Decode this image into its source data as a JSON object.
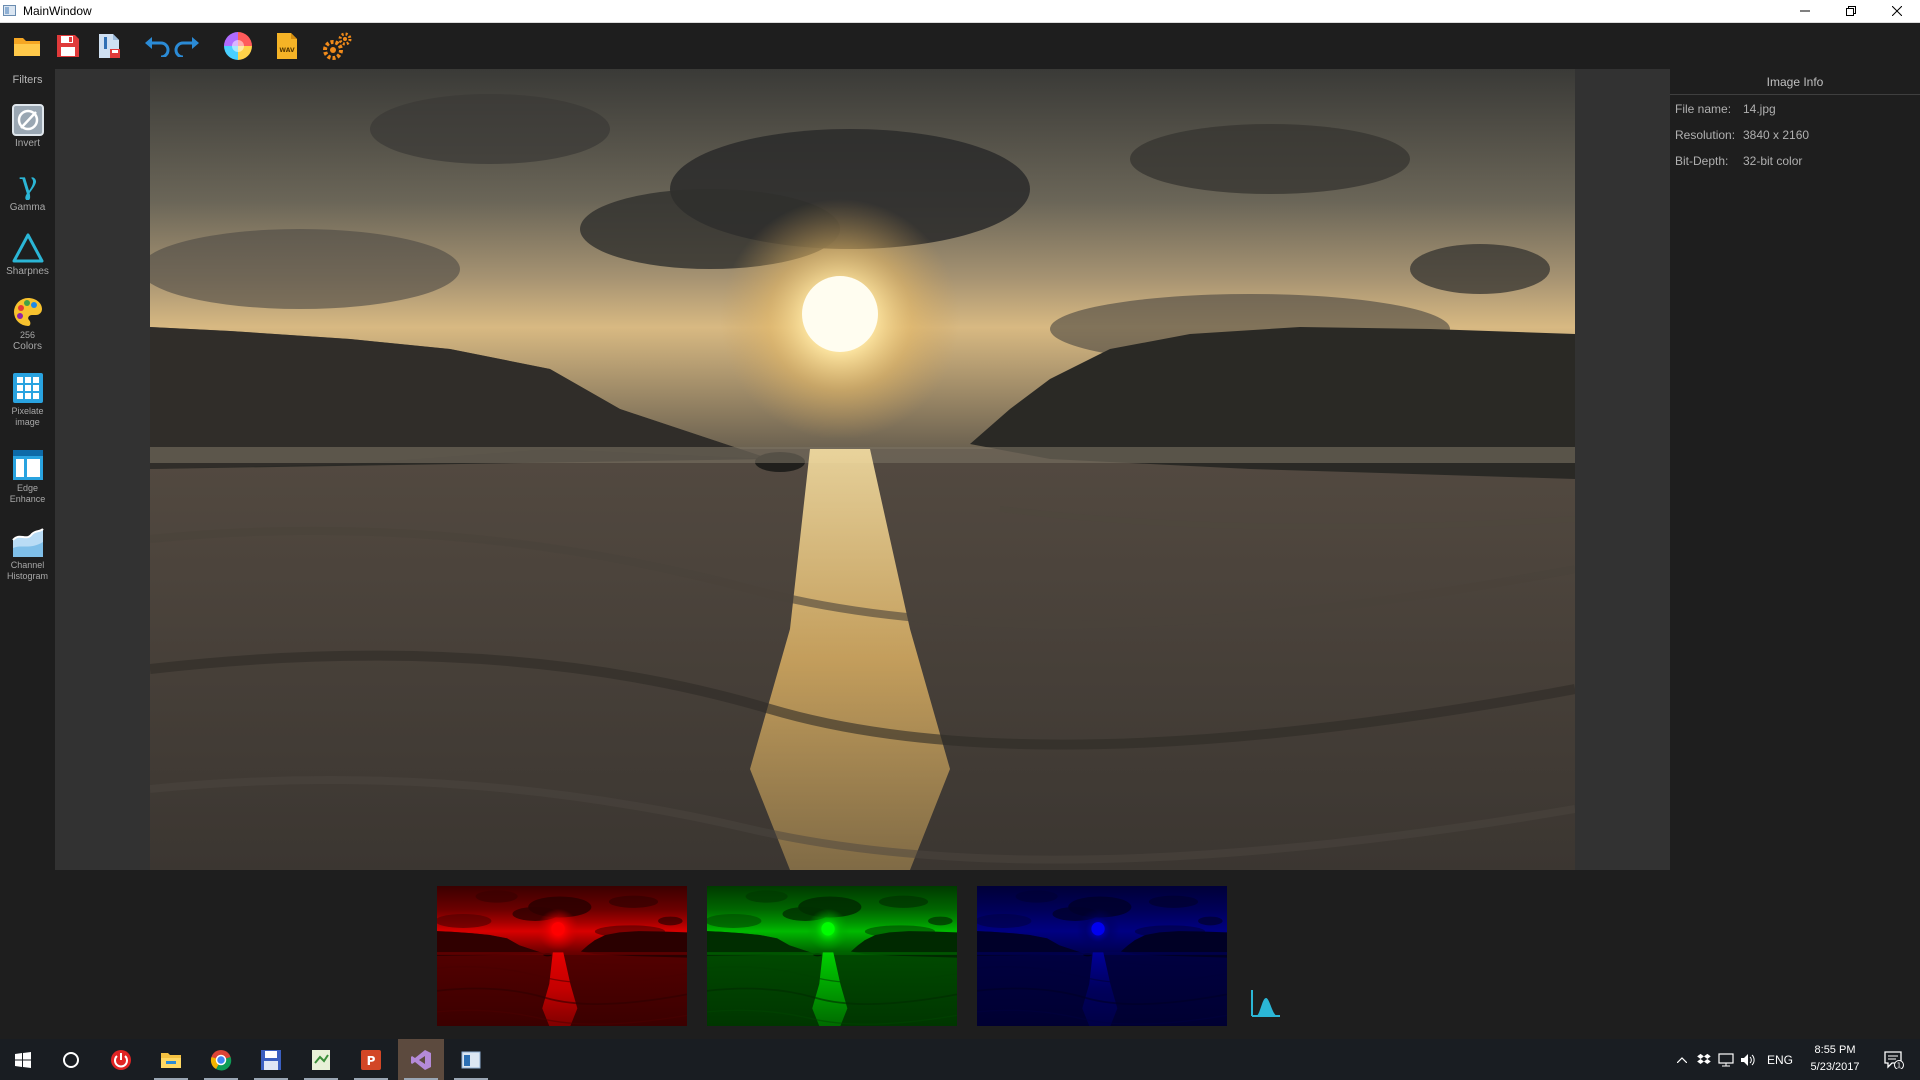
{
  "window": {
    "title": "MainWindow",
    "controls": [
      "minimize",
      "restore",
      "close"
    ]
  },
  "toolbar": {
    "buttons": [
      {
        "name": "open-folder-icon"
      },
      {
        "name": "save-icon"
      },
      {
        "name": "save-as-icon"
      },
      {
        "name": "undo-icon"
      },
      {
        "name": "redo-icon"
      },
      {
        "name": "color-wheel-icon"
      },
      {
        "name": "wav-file-icon",
        "text": "WAV"
      },
      {
        "name": "settings-gears-icon"
      }
    ]
  },
  "sidebar": {
    "header": "Filters",
    "items": [
      {
        "label": "Invert",
        "icon": "invert-icon"
      },
      {
        "label": "Gamma",
        "icon": "gamma-icon",
        "glyph": "γ"
      },
      {
        "label": "Sharpnes",
        "icon": "sharpness-icon"
      },
      {
        "label_line1": "256",
        "label_line2": "Colors",
        "icon": "palette-icon"
      },
      {
        "label_line1": "Pixelate",
        "label_line2": "image",
        "icon": "pixelate-icon"
      },
      {
        "label_line1": "Edge",
        "label_line2": "Enhance",
        "icon": "edge-enhance-icon"
      },
      {
        "label_line1": "Channel",
        "label_line2": "Histogram",
        "icon": "channel-histogram-icon"
      }
    ]
  },
  "image_info": {
    "header": "Image Info",
    "rows": [
      {
        "key": "File name:",
        "value": "14.jpg"
      },
      {
        "key": "Resolution:",
        "value": "3840 x 2160"
      },
      {
        "key": "Bit-Depth:",
        "value": "32-bit color"
      }
    ]
  },
  "channels": {
    "items": [
      "red-channel-preview",
      "green-channel-preview",
      "blue-channel-preview"
    ],
    "colors": [
      "#ff0000",
      "#00ff00",
      "#0000ff"
    ],
    "histogram_icon": "histogram-icon"
  },
  "taskbar": {
    "apps": [
      "start-icon",
      "cortana-icon",
      "power-icon",
      "file-explorer-icon",
      "chrome-icon",
      "floppy-app-icon",
      "notepad-icon",
      "powerpoint-icon",
      "visual-studio-icon",
      "main-window-app-icon"
    ],
    "tray": {
      "language": "ENG",
      "time": "8:55 PM",
      "date": "5/23/2017",
      "notifications": "1"
    }
  }
}
